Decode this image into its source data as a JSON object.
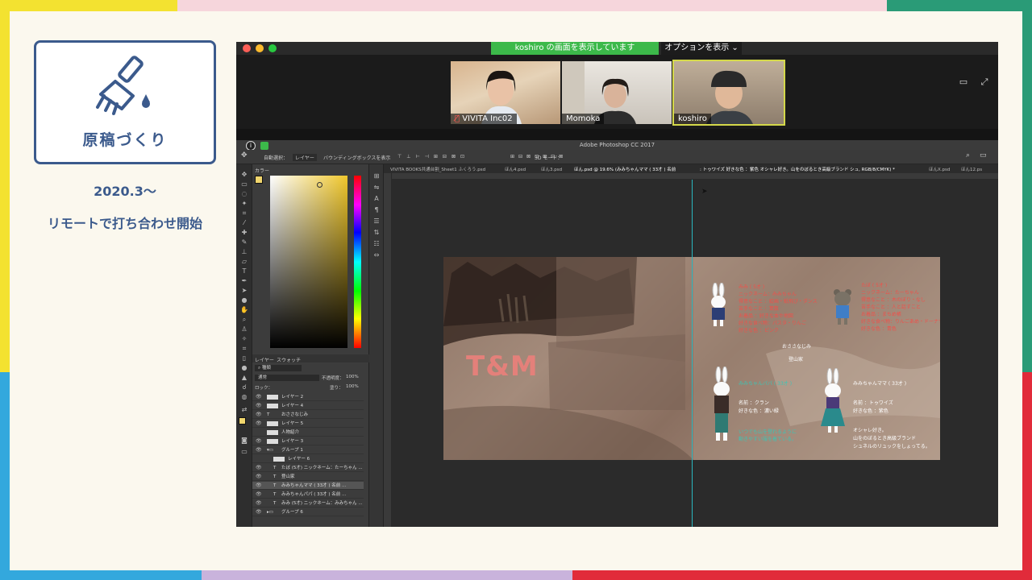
{
  "slide": {
    "title": "原稿づくり",
    "date": "2020.3〜",
    "subtitle": "リモートで打ち合わせ開始"
  },
  "zoom": {
    "share_banner": "koshiro の画面を表示しています",
    "options_label": "オプションを表示 ⌄",
    "participants": [
      {
        "name": "VIVITA Inc02",
        "muted": true
      },
      {
        "name": "Momoka",
        "muted": false
      },
      {
        "name": "koshiro",
        "muted": false,
        "active": true
      }
    ]
  },
  "photoshop": {
    "app_title": "Adobe Photoshop CC 2017",
    "options_bar": {
      "auto_select": "自動選択：",
      "auto_select_target": "レイヤー",
      "bounding_box": "バウンディングボックスを表示",
      "mode_3d": "3D モード："
    },
    "doc_tabs": [
      "VIVITA BOOKS共通台割_Sheet1 ふくろう.psd",
      "ほん4.psd",
      "ほん3.psd",
      "ほん.psd @ 19.6% (みみちゃんママ ( 33才 )  名前",
      ": トゥワイズ 好きな色 ：紫色 オシャレ好き。山をのぼるとき高級ブランド シュ, RGB/8/CMYK) *",
      "ほんX.psd",
      "ほん12.ps"
    ],
    "panels": {
      "color_tab": "カラー",
      "layers_tab": "レイヤー",
      "swatches_tab": "スウォッチ",
      "kind_filter": "種類",
      "blend_mode": "通常",
      "opacity_label": "不透明度：",
      "opacity_value": "100%",
      "lock_label": "ロック：",
      "fill_label": "塗り：",
      "fill_value": "100%"
    },
    "layers": [
      {
        "name": "レイヤー 2",
        "type": "pixel"
      },
      {
        "name": "レイヤー 4",
        "type": "pixel"
      },
      {
        "name": "おささなじみ",
        "type": "text"
      },
      {
        "name": "レイヤー 5",
        "type": "pixel"
      },
      {
        "name": "人物紹介",
        "type": "pixel"
      },
      {
        "name": "レイヤー 3",
        "type": "pixel"
      },
      {
        "name": "グループ 1",
        "type": "group"
      },
      {
        "name": "レイヤー 6",
        "type": "pixel"
      },
      {
        "name": "たぼ (5才) ニックネーム：たーちゃん ...",
        "type": "text"
      },
      {
        "name": "登山家",
        "type": "text"
      },
      {
        "name": "みみちゃんママ ( 33才 ) 名前 ...",
        "type": "text",
        "selected": true
      },
      {
        "name": "みみちゃんパパ ( 33才 ) 名前 ...",
        "type": "text"
      },
      {
        "name": "みみ (5才) ニックネーム：みみちゃん ...",
        "type": "text"
      },
      {
        "name": "グループ 6",
        "type": "group"
      }
    ],
    "artboard": {
      "logo": "T&M",
      "label_osananajimi": "おささなじみ",
      "label_tozanka": "登山家",
      "mimi_profile": [
        "みみ ( 5才 )",
        "ニックネーム：みみちゃん",
        "得意なこと ：絵画・紙飛び・ダンス",
        "苦手なこと ：算数",
        "お着品 ：好きな本や地図",
        "好きな食べ物：パスタ・りんご",
        "好きな色 ：ピンク"
      ],
      "tabo_profile": [
        "たぼ ( 5才 )",
        "ニックネーム：たーちゃん",
        "得意なこと ：木のぼり・なし",
        "苦手なこと ：人と話すこと",
        "お着品 ：まちめ帳",
        "好きな食べ物：りんごあめ・ドーナツ",
        "好きな色 ：青色"
      ],
      "papa_profile": [
        "みみちゃんパパ ( 33才 )",
        "名前 ：クラン",
        "好きな色 ：濃い緑",
        "いつでも山を登れるように",
        "動きやすい服を着ている。"
      ],
      "mama_profile": [
        "みみちゃんママ ( 33才 )",
        "名前 ：トゥワイズ",
        "好きな色 ：紫色",
        "オシャレ好き。",
        "山をのぼるとき高級ブランド",
        "シュネルのリュックをしょってる。"
      ]
    }
  },
  "colors": {
    "brand_navy": "#3b5a8c",
    "zoom_green": "#3cb94a",
    "guide_cyan": "#2ab7c0",
    "profile_red": "#f0504a",
    "profile_teal": "#3ec4b4"
  },
  "icons": [
    "brush-icon",
    "mic-muted-icon",
    "speaker-view-icon",
    "fullscreen-icon",
    "info-icon",
    "shield-icon"
  ]
}
